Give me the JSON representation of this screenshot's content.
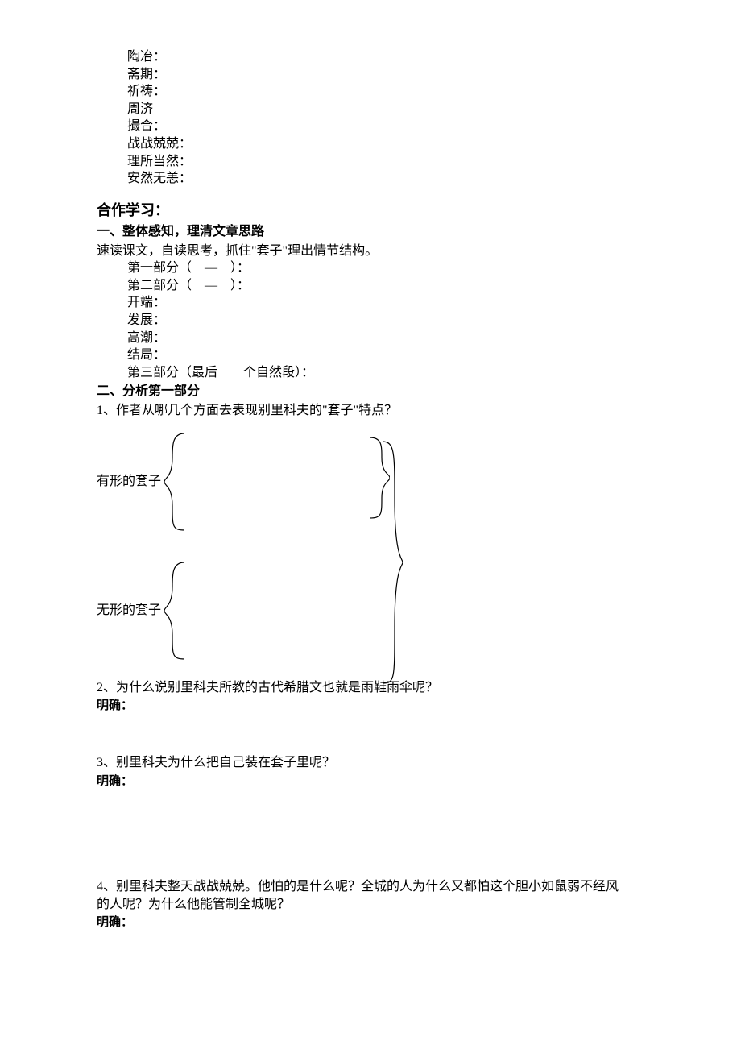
{
  "terms": [
    "陶冶：",
    "斋期：",
    "祈祷：",
    "周济",
    "撮合：",
    "战战兢兢：",
    "理所当然：",
    "安然无恙："
  ],
  "heading_coop": "合作学习：",
  "section1": {
    "title": "一、整体感知，理清文章思路",
    "intro": "速读课文，自读思考，抓住\"套子\"理出情节结构。",
    "lines": [
      "第一部分（　―　）：",
      "第二部分（　―　）：",
      "开端：",
      "发展：",
      "高潮：",
      "结局：",
      "第三部分（最后　　个自然段）："
    ]
  },
  "section2": {
    "title": "二、分析第一部分",
    "q1": "1、作者从哪几个方面去表现别里科夫的\"套子\"特点？",
    "label_visible": "有形的套子",
    "label_invisible": "无形的套子",
    "q2": "2、为什么说别里科夫所教的古代希腊文也就是雨鞋雨伞呢？",
    "q3": "3、别里科夫为什么把自己装在套子里呢？",
    "q4a": "4、别里科夫整天战战兢兢。他怕的是什么呢？全城的人为什么又都怕这个胆小如鼠弱不经风",
    "q4b": "的人呢？为什么他能管制全城呢？",
    "answer_label": "明确："
  }
}
